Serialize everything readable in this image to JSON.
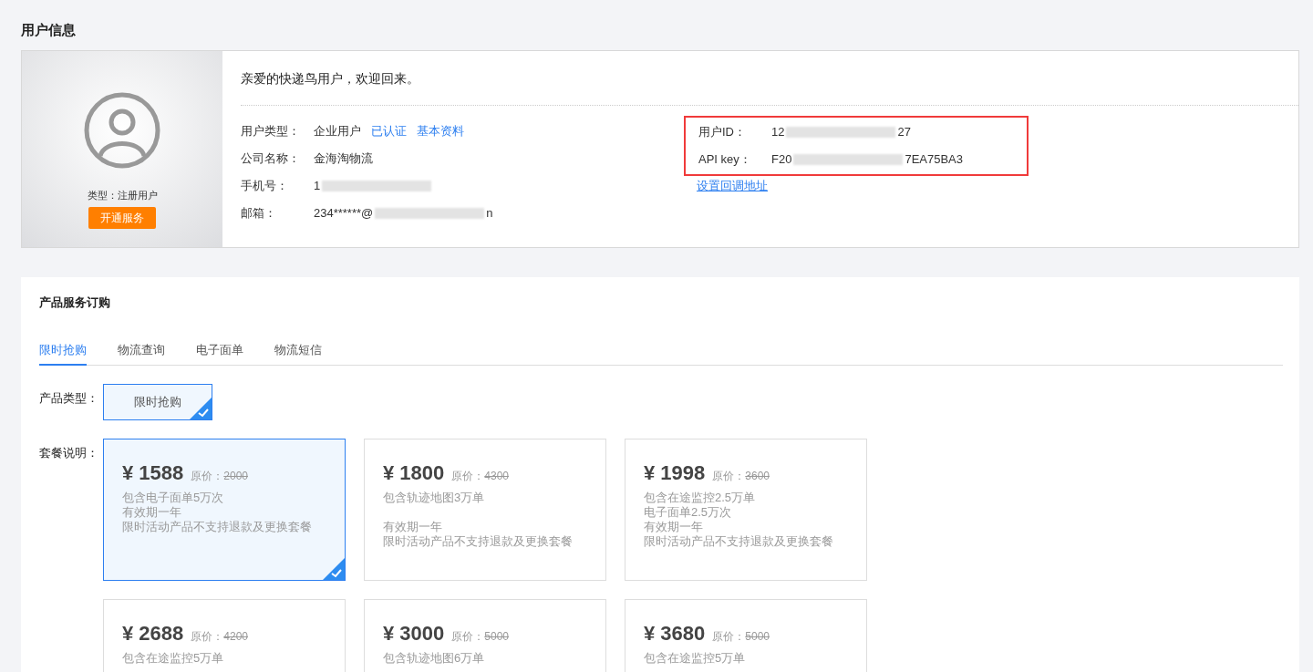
{
  "page_title": "用户信息",
  "user_card": {
    "avatar_type": "类型：注册用户",
    "activate_button": "开通服务",
    "welcome": "亲爱的快递鸟用户，欢迎回来。",
    "left_fields": [
      {
        "label": "用户类型：",
        "value": "企业用户",
        "links": [
          "已认证",
          "基本资料"
        ]
      },
      {
        "label": "公司名称：",
        "value": "金海淘物流"
      },
      {
        "label": "手机号：",
        "value": "1",
        "redacted": true
      },
      {
        "label": "邮箱：",
        "value": "234******@",
        "suffix": "n",
        "redacted": true
      }
    ],
    "right_fields": [
      {
        "label": "用户ID：",
        "value": "12",
        "suffix": "27",
        "redacted": true
      },
      {
        "label": "API key：",
        "value": "F20",
        "suffix": "7EA75BA3",
        "redacted": true
      }
    ],
    "highlighted": true,
    "callback_link": "设置回调地址"
  },
  "products": {
    "title": "产品服务订购",
    "tabs": [
      {
        "label": "限时抢购",
        "selected": true
      },
      {
        "label": "物流查询",
        "selected": false
      },
      {
        "label": "电子面单",
        "selected": false
      },
      {
        "label": "物流短信",
        "selected": false
      }
    ],
    "type_label": "产品类型：",
    "types": [
      {
        "label": "限时抢购",
        "selected": true
      }
    ],
    "package_label": "套餐说明：",
    "packages": [
      {
        "price": "¥ 1588",
        "orig_label": "原价：",
        "orig": "2000",
        "lines": [
          "包含电子面单5万次",
          "有效期一年",
          "限时活动产品不支持退款及更换套餐"
        ],
        "selected": true
      },
      {
        "price": "¥ 1800",
        "orig_label": "原价：",
        "orig": "4300",
        "lines": [
          "包含轨迹地图3万单",
          "有效期一年",
          "限时活动产品不支持退款及更换套餐"
        ],
        "gap_after_first": true,
        "selected": false
      },
      {
        "price": "¥ 1998",
        "orig_label": "原价：",
        "orig": "3600",
        "lines": [
          "包含在途监控2.5万单",
          "电子面单2.5万次",
          "有效期一年",
          "限时活动产品不支持退款及更换套餐"
        ],
        "selected": false
      },
      {
        "price": "¥ 2688",
        "orig_label": "原价：",
        "orig": "4200",
        "lines": [
          "包含在途监控5万单"
        ],
        "selected": false
      },
      {
        "price": "¥ 3000",
        "orig_label": "原价：",
        "orig": "5000",
        "lines": [
          "包含轨迹地图6万单"
        ],
        "selected": false
      },
      {
        "price": "¥ 3680",
        "orig_label": "原价：",
        "orig": "5000",
        "lines": [
          "包含在途监控5万单"
        ],
        "selected": false
      }
    ]
  }
}
